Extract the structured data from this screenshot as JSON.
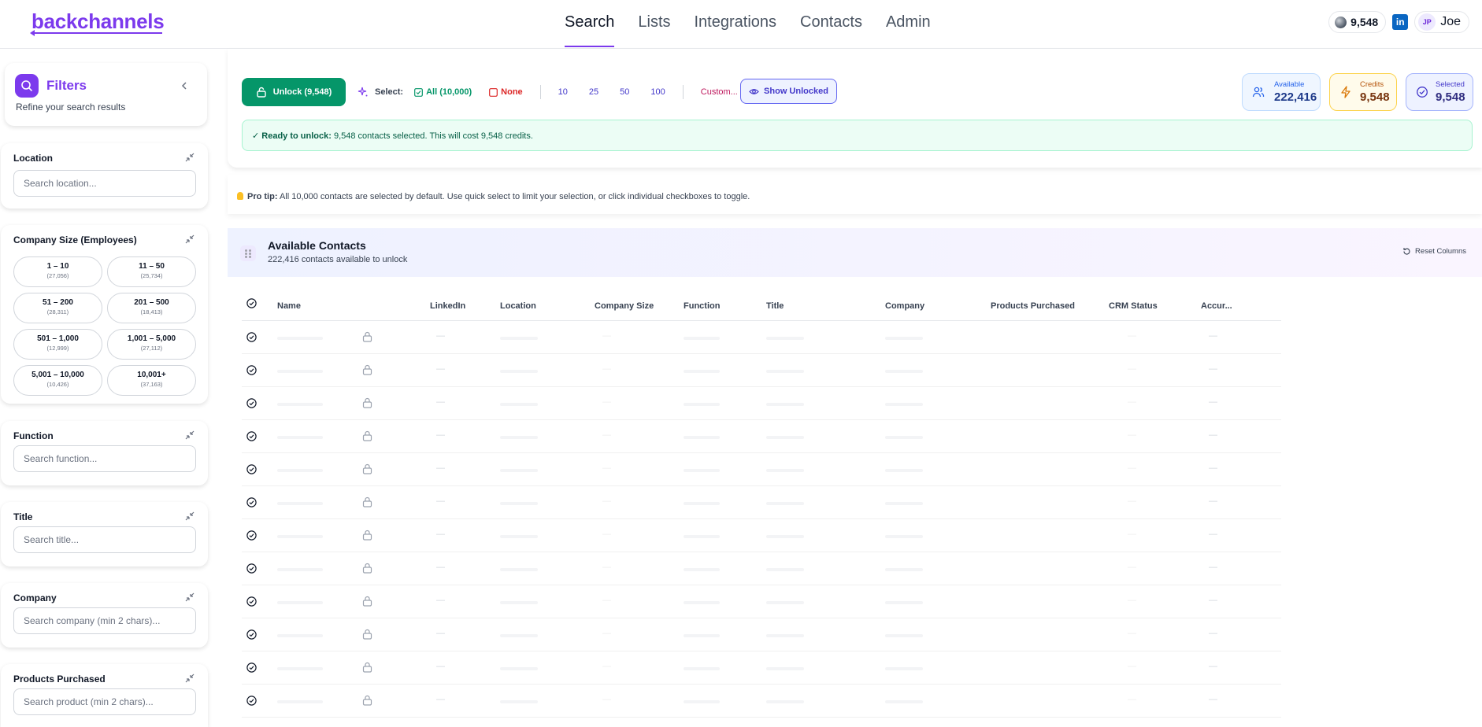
{
  "app": {
    "logo": "backchannels",
    "nav": [
      "Search",
      "Lists",
      "Integrations",
      "Contacts",
      "Admin"
    ],
    "active_nav": "Search",
    "credits_pill": "9,548",
    "linkedin_badge": "in",
    "user_initials": "JP",
    "user_name": "Joe"
  },
  "sidebar": {
    "header": {
      "title": "Filters",
      "subtitle": "Refine your search results"
    },
    "location": {
      "label": "Location",
      "placeholder": "Search location..."
    },
    "company_size": {
      "label": "Company Size (Employees)",
      "options": [
        {
          "label": "1 – 10",
          "count": "(27,056)"
        },
        {
          "label": "11 – 50",
          "count": "(25,734)"
        },
        {
          "label": "51 – 200",
          "count": "(28,311)"
        },
        {
          "label": "201 – 500",
          "count": "(18,413)"
        },
        {
          "label": "501 – 1,000",
          "count": "(12,999)"
        },
        {
          "label": "1,001 – 5,000",
          "count": "(27,112)"
        },
        {
          "label": "5,001 – 10,000",
          "count": "(10,426)"
        },
        {
          "label": "10,001+",
          "count": "(37,163)"
        }
      ]
    },
    "function": {
      "label": "Function",
      "placeholder": "Search function..."
    },
    "title": {
      "label": "Title",
      "placeholder": "Search title..."
    },
    "company": {
      "label": "Company",
      "placeholder": "Search company (min 2 chars)..."
    },
    "products": {
      "label": "Products Purchased",
      "placeholder": "Search product (min 2 chars)..."
    }
  },
  "toolbar": {
    "unlock_label": "Unlock (9,548)",
    "select_label": "Select:",
    "all_label": "All (10,000)",
    "none_label": "None",
    "quick_counts": [
      "10",
      "25",
      "50",
      "100"
    ],
    "custom_label": "Custom...",
    "show_unlocked_label": "Show Unlocked"
  },
  "stats": {
    "available": {
      "label": "Available",
      "value": "222,416"
    },
    "credits": {
      "label": "Credits",
      "value": "9,548"
    },
    "selected": {
      "label": "Selected",
      "value": "9,548"
    }
  },
  "ready": {
    "prefix": "✓ Ready to unlock:",
    "text": "9,548 contacts selected. This will cost 9,548 credits."
  },
  "protip": {
    "prefix": "Pro tip:",
    "text": "All 10,000 contacts are selected by default. Use quick select to limit your selection, or click individual checkboxes to toggle."
  },
  "contacts": {
    "title": "Available Contacts",
    "subtitle": "222,416 contacts available to unlock",
    "reset_label": "Reset Columns",
    "columns": [
      "Name",
      "LinkedIn",
      "Location",
      "Company Size",
      "Function",
      "Title",
      "Company",
      "Products Purchased",
      "CRM Status",
      "Accur..."
    ],
    "placeholder_dash": "—"
  },
  "colors": {
    "brand": "#7c3aed",
    "unlock_green": "#059669",
    "none_red": "#dc2626",
    "indigo": "#4338ca"
  }
}
